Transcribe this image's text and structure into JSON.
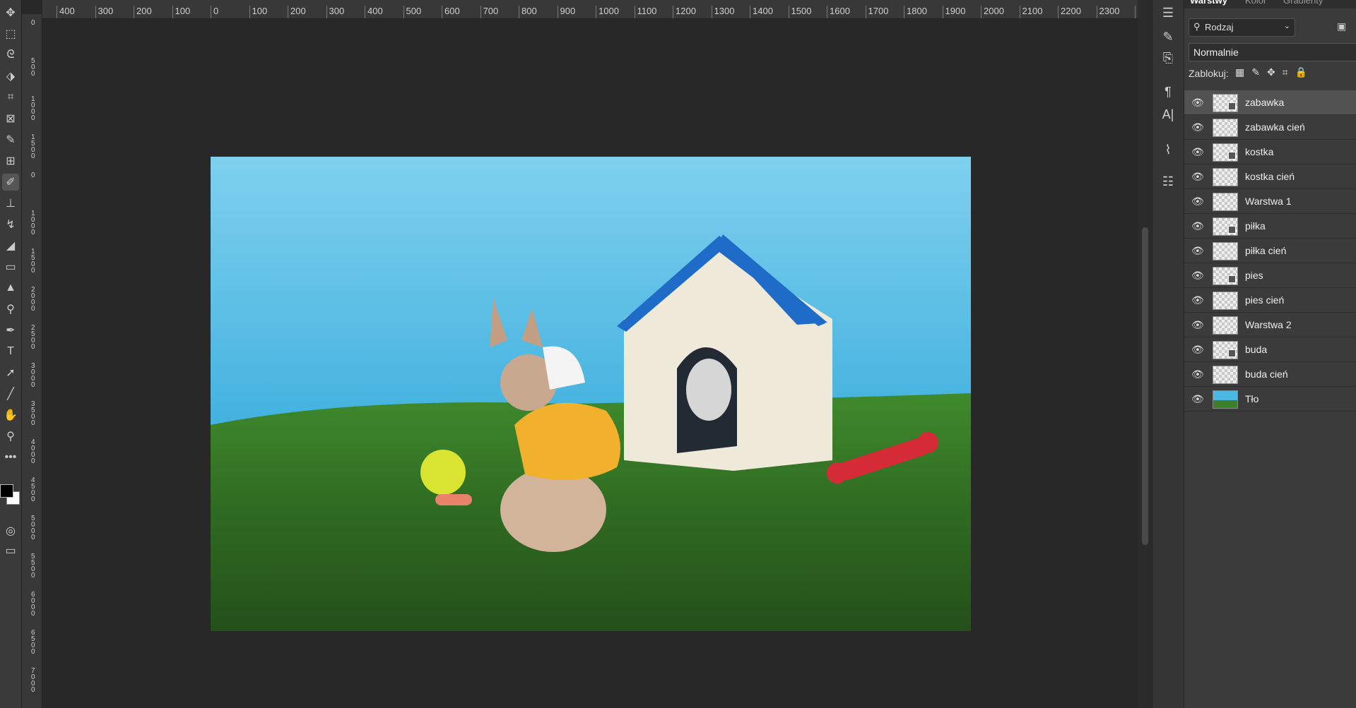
{
  "ruler_top": [
    "400",
    "300",
    "200",
    "100",
    "0",
    "100",
    "200",
    "300",
    "400",
    "500",
    "600",
    "700",
    "800",
    "900",
    "1000",
    "1100",
    "1200",
    "1300",
    "1400",
    "1500",
    "1600",
    "1700",
    "1800",
    "1900",
    "2000",
    "2100",
    "2200",
    "2300",
    "2"
  ],
  "ruler_left": [
    "0",
    "500",
    "1000",
    "1500",
    "0",
    "1000",
    "1500",
    "2000",
    "2500",
    "3000",
    "3500",
    "4000",
    "4500",
    "5000",
    "5500",
    "6000",
    "6500",
    "7000"
  ],
  "toolbar": [
    {
      "name": "move-tool-icon",
      "glyph": "✥"
    },
    {
      "name": "marquee-tool-icon",
      "glyph": "⬚"
    },
    {
      "name": "lasso-tool-icon",
      "glyph": "ᘓ"
    },
    {
      "name": "object-select-tool-icon",
      "glyph": "⬗"
    },
    {
      "name": "crop-tool-icon",
      "glyph": "⌗"
    },
    {
      "name": "frame-tool-icon",
      "glyph": "⊠"
    },
    {
      "name": "eyedropper-tool-icon",
      "glyph": "✎"
    },
    {
      "name": "patch-tool-icon",
      "glyph": "⊞"
    },
    {
      "name": "brush-tool-icon",
      "glyph": "✐"
    },
    {
      "name": "stamp-tool-icon",
      "glyph": "⊥"
    },
    {
      "name": "history-brush-tool-icon",
      "glyph": "↯"
    },
    {
      "name": "eraser-tool-icon",
      "glyph": "◢"
    },
    {
      "name": "gradient-tool-icon",
      "glyph": "▭"
    },
    {
      "name": "blur-tool-icon",
      "glyph": "▲"
    },
    {
      "name": "dodge-tool-icon",
      "glyph": "⚲"
    },
    {
      "name": "pen-tool-icon",
      "glyph": "✒"
    },
    {
      "name": "type-tool-icon",
      "glyph": "T"
    },
    {
      "name": "path-select-tool-icon",
      "glyph": "➚"
    },
    {
      "name": "line-tool-icon",
      "glyph": "╱"
    },
    {
      "name": "hand-tool-icon",
      "glyph": "✋"
    },
    {
      "name": "zoom-tool-icon",
      "glyph": "⚲"
    },
    {
      "name": "more-tools-icon",
      "glyph": "•••"
    }
  ],
  "mid_icons": [
    {
      "name": "properties-icon",
      "glyph": "☰"
    },
    {
      "name": "brush-settings-icon",
      "glyph": "✎"
    },
    {
      "name": "clone-source-icon",
      "glyph": "⎘"
    },
    {
      "name": "paragraph-icon",
      "glyph": "¶"
    },
    {
      "name": "character-icon",
      "glyph": "A|"
    },
    {
      "name": "paths-icon",
      "glyph": "⌇"
    },
    {
      "name": "adjustments-icon",
      "glyph": "☷"
    }
  ],
  "panel": {
    "tabs": [
      "Warstwy",
      "Kolor",
      "Gradienty"
    ],
    "filter_label": "Rodzaj",
    "blend_mode": "Normalnie",
    "lock_label": "Zablokuj:"
  },
  "layers": [
    {
      "name": "zabawka",
      "thumb": "smart",
      "selected": true
    },
    {
      "name": "zabawka cień",
      "thumb": "blank",
      "selected": false
    },
    {
      "name": "kostka",
      "thumb": "smart",
      "selected": false
    },
    {
      "name": "kostka cień",
      "thumb": "blank",
      "selected": false
    },
    {
      "name": "Warstwa 1",
      "thumb": "blank",
      "selected": false
    },
    {
      "name": "piłka",
      "thumb": "smart",
      "selected": false
    },
    {
      "name": "piłka cień",
      "thumb": "blank",
      "selected": false
    },
    {
      "name": "pies",
      "thumb": "smart",
      "selected": false
    },
    {
      "name": "pies cień",
      "thumb": "blank",
      "selected": false
    },
    {
      "name": "Warstwa 2",
      "thumb": "blank",
      "selected": false
    },
    {
      "name": "buda",
      "thumb": "smart",
      "selected": false
    },
    {
      "name": "buda cień",
      "thumb": "blank",
      "selected": false
    },
    {
      "name": "Tło",
      "thumb": "sky",
      "selected": false
    }
  ],
  "colors": {
    "foreground": "#000000",
    "background": "#ffffff"
  }
}
